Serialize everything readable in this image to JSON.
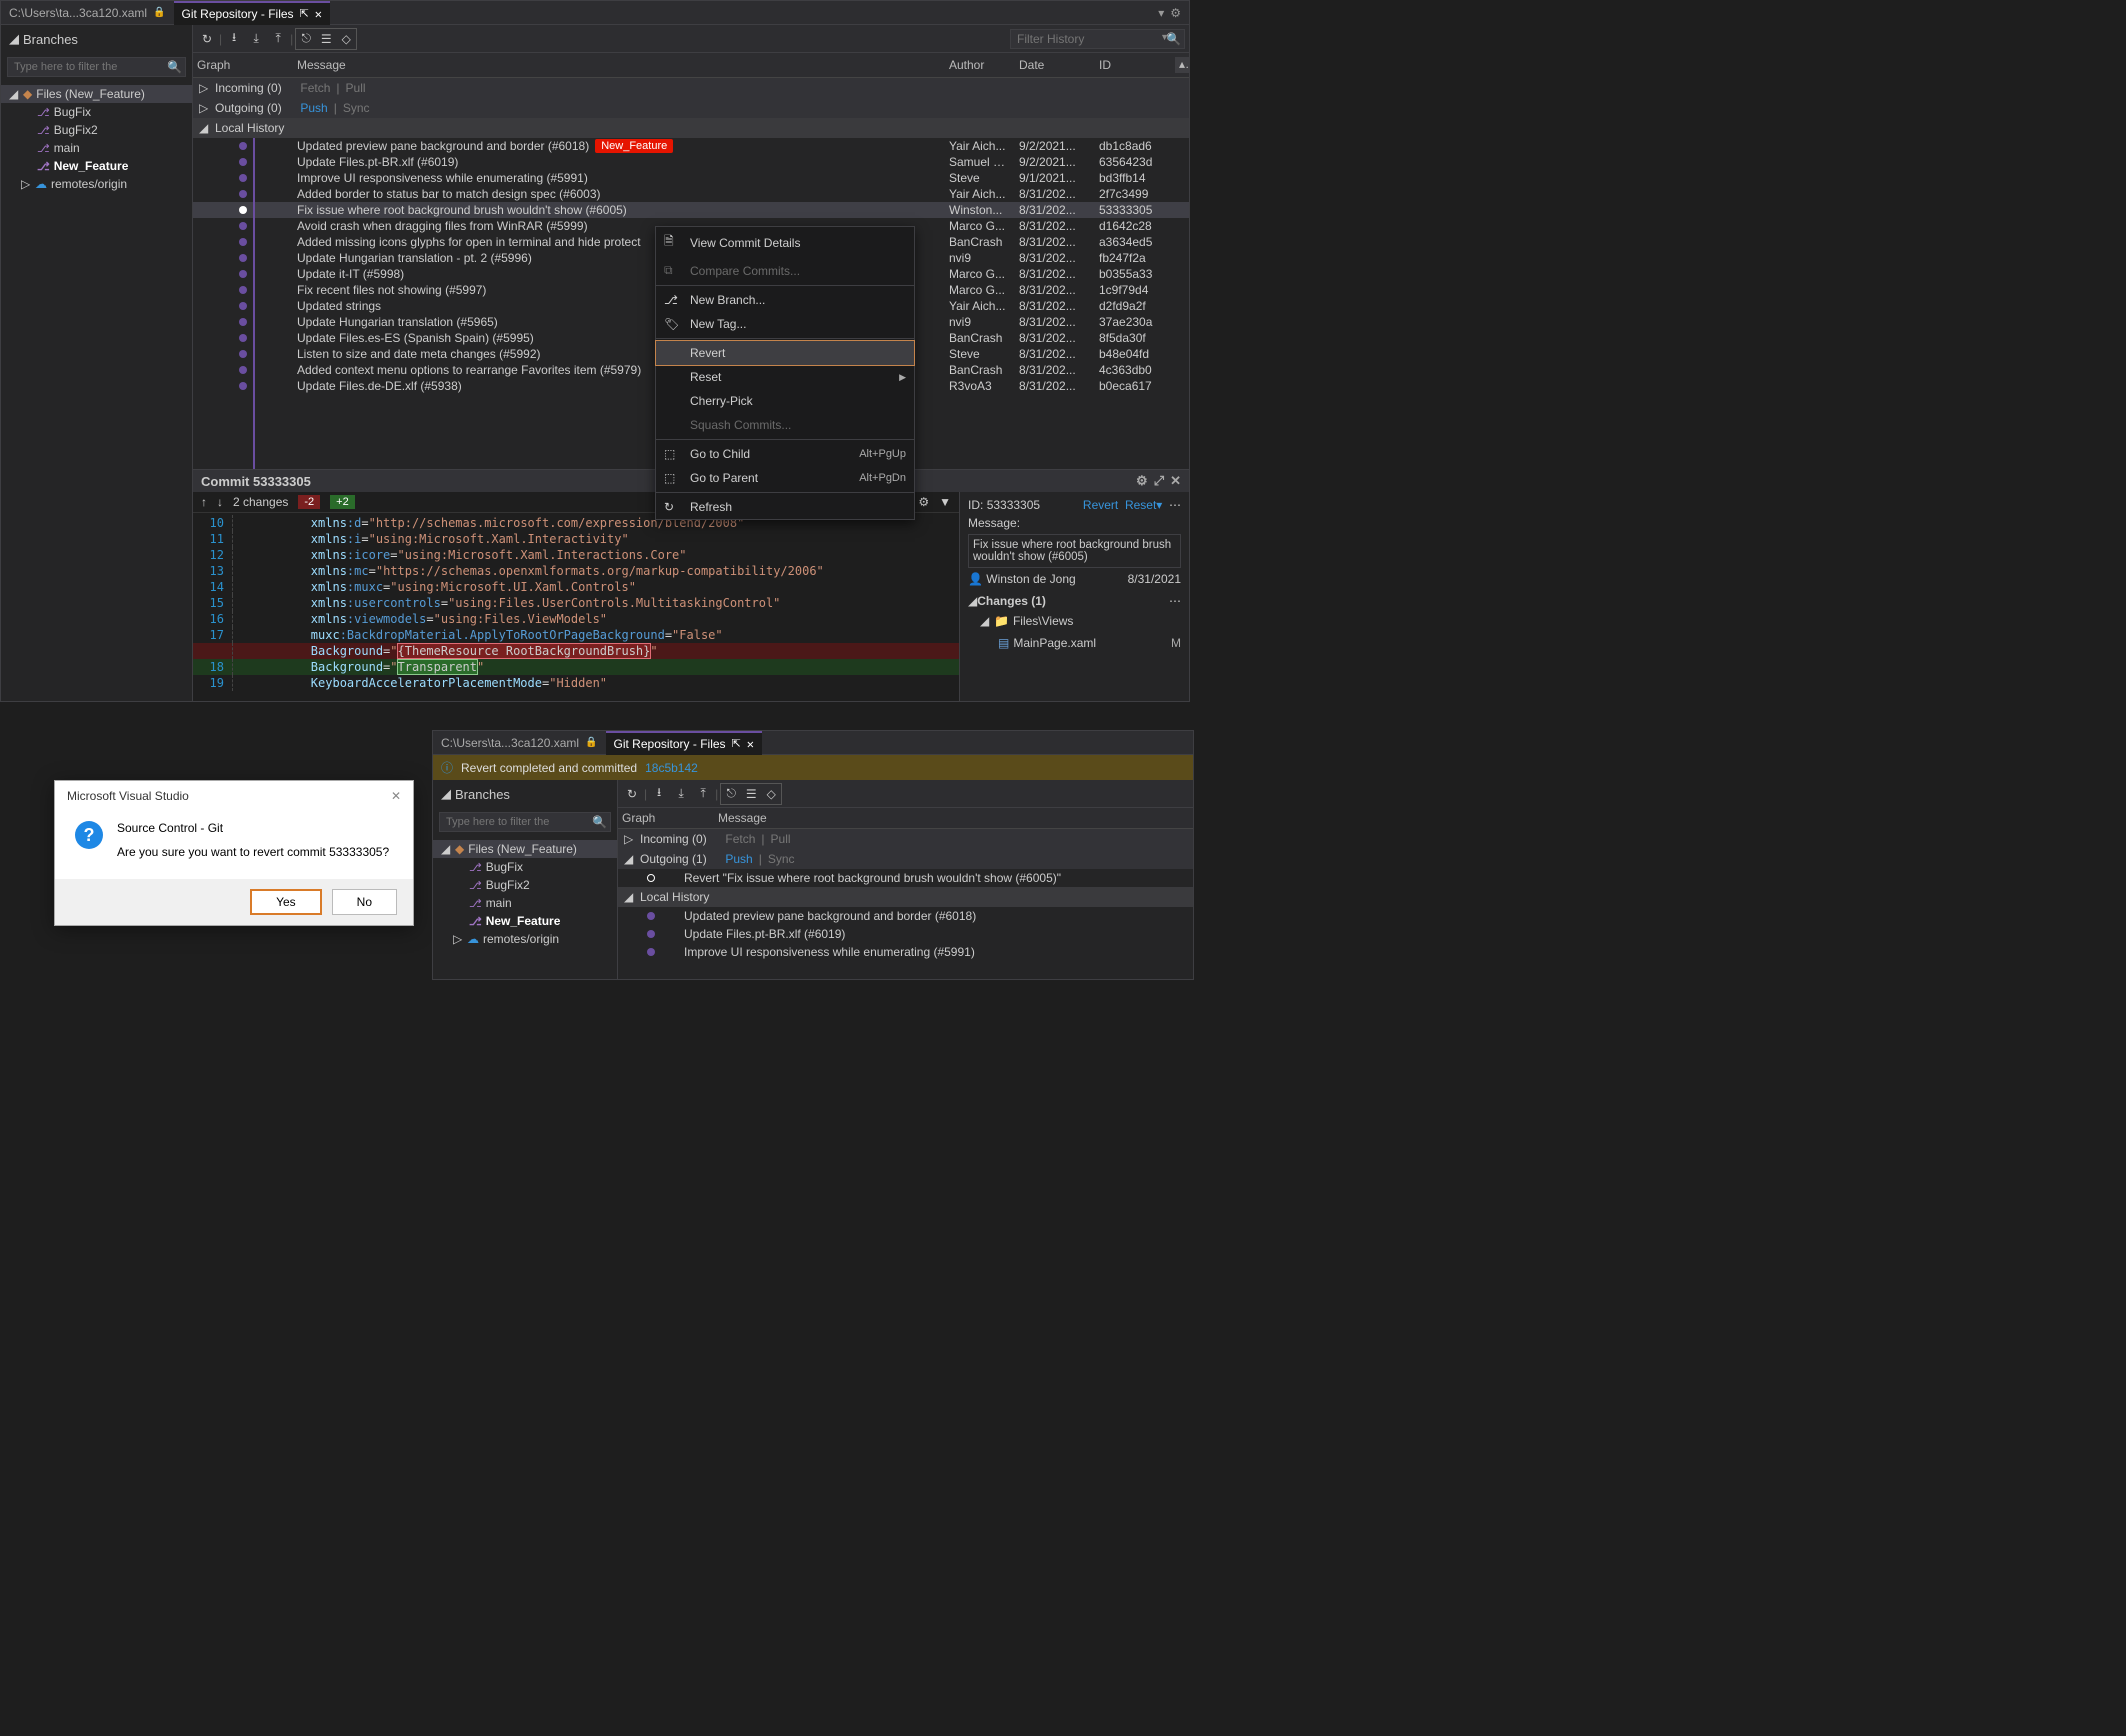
{
  "tabs": {
    "file_tab": "C:\\Users\\ta...3ca120.xaml",
    "repo_tab": "Git Repository - Files"
  },
  "branches_panel": {
    "title": "Branches",
    "search_placeholder": "Type here to filter the",
    "root": "Files (New_Feature)",
    "branches": [
      "BugFix",
      "BugFix2",
      "main",
      "New_Feature"
    ],
    "remotes": "remotes/origin"
  },
  "history": {
    "filter_placeholder": "Filter History",
    "cols": {
      "graph": "Graph",
      "message": "Message",
      "author": "Author",
      "date": "Date",
      "id": "ID"
    },
    "incoming": {
      "label": "Incoming (0)",
      "fetch": "Fetch",
      "pull": "Pull"
    },
    "outgoing": {
      "label": "Outgoing (0)",
      "push": "Push",
      "sync": "Sync"
    },
    "local_header": "Local History",
    "selected_badge": "New_Feature",
    "commits": [
      {
        "msg": "Updated preview pane background and border (#6018)",
        "author": "Yair Aich...",
        "date": "9/2/2021...",
        "id": "db1c8ad6",
        "badge": true
      },
      {
        "msg": "Update Files.pt-BR.xlf (#6019)",
        "author": "Samuel R...",
        "date": "9/2/2021...",
        "id": "6356423d"
      },
      {
        "msg": "Improve UI responsiveness while enumerating (#5991)",
        "author": "Steve",
        "date": "9/1/2021...",
        "id": "bd3ffb14"
      },
      {
        "msg": "Added border to status bar to match design spec (#6003)",
        "author": "Yair Aich...",
        "date": "8/31/202...",
        "id": "2f7c3499"
      },
      {
        "msg": "Fix issue where root background brush wouldn't show (#6005)",
        "author": "Winston...",
        "date": "8/31/202...",
        "id": "53333305",
        "selected": true
      },
      {
        "msg": " Avoid crash when dragging files from WinRAR (#5999)",
        "author": "Marco G...",
        "date": "8/31/202...",
        "id": "d1642c28"
      },
      {
        "msg": "Added missing icons glyphs for open in terminal and hide protect",
        "author": "BanCrash",
        "date": "8/31/202...",
        "id": "a3634ed5"
      },
      {
        "msg": "Update Hungarian translation - pt. 2 (#5996)",
        "author": "nvi9",
        "date": "8/31/202...",
        "id": "fb247f2a"
      },
      {
        "msg": "Update it-IT (#5998)",
        "author": "Marco G...",
        "date": "8/31/202...",
        "id": "b0355a33"
      },
      {
        "msg": "Fix recent files not showing (#5997)",
        "author": "Marco G...",
        "date": "8/31/202...",
        "id": "1c9f79d4"
      },
      {
        "msg": "Updated strings",
        "author": "Yair Aich...",
        "date": "8/31/202...",
        "id": "d2fd9a2f"
      },
      {
        "msg": "Update Hungarian translation (#5965)",
        "author": "nvi9",
        "date": "8/31/202...",
        "id": "37ae230a"
      },
      {
        "msg": "Update Files.es-ES (Spanish Spain) (#5995)",
        "author": "BanCrash",
        "date": "8/31/202...",
        "id": "8f5da30f"
      },
      {
        "msg": "Listen to size and date meta changes (#5992)",
        "author": "Steve",
        "date": "8/31/202...",
        "id": "b48e04fd"
      },
      {
        "msg": "Added context menu options to rearrange Favorites item (#5979)",
        "author": "BanCrash",
        "date": "8/31/202...",
        "id": "4c363db0"
      },
      {
        "msg": "Update Files.de-DE.xlf (#5938)",
        "author": "R3voA3",
        "date": "8/31/202...",
        "id": "b0eca617"
      }
    ]
  },
  "context_menu": {
    "view_details": "View Commit Details",
    "compare": "Compare Commits...",
    "new_branch": "New Branch...",
    "new_tag": "New Tag...",
    "revert": "Revert",
    "reset": "Reset",
    "cherry": "Cherry-Pick",
    "squash": "Squash Commits...",
    "go_child": "Go to Child",
    "go_child_sc": "Alt+PgUp",
    "go_parent": "Go to Parent",
    "go_parent_sc": "Alt+PgDn",
    "refresh": "Refresh"
  },
  "diff": {
    "title": "Commit 53333305",
    "changes_label": "2 changes",
    "neg": "-2",
    "pos": "+2",
    "lines": [
      {
        "n": "10",
        "pre": "        ",
        "k": "xmlns",
        "a": ":d",
        "v": "\"http://schemas.microsoft.com/expression/blend/2008\""
      },
      {
        "n": "11",
        "pre": "        ",
        "k": "xmlns",
        "a": ":i",
        "v": "\"using:Microsoft.Xaml.Interactivity\""
      },
      {
        "n": "12",
        "pre": "        ",
        "k": "xmlns",
        "a": ":icore",
        "v": "\"using:Microsoft.Xaml.Interactions.Core\""
      },
      {
        "n": "13",
        "pre": "        ",
        "k": "xmlns",
        "a": ":mc",
        "v": "\"https://schemas.openxmlformats.org/markup-compatibility/2006\""
      },
      {
        "n": "14",
        "pre": "        ",
        "k": "xmlns",
        "a": ":muxc",
        "v": "\"using:Microsoft.UI.Xaml.Controls\""
      },
      {
        "n": "15",
        "pre": "        ",
        "k": "xmlns",
        "a": ":usercontrols",
        "v": "\"using:Files.UserControls.MultitaskingControl\""
      },
      {
        "n": "16",
        "pre": "        ",
        "k": "xmlns",
        "a": ":viewmodels",
        "v": "\"using:Files.ViewModels\""
      },
      {
        "n": "17",
        "pre": "        ",
        "k": "muxc",
        "a": ":BackdropMaterial.ApplyToRootOrPageBackground",
        "v": "\"False\""
      },
      {
        "n": "",
        "pre": "        ",
        "k": "Background",
        "a": "",
        "v": "\"",
        "frag": "{ThemeResource RootBackgroundBrush}",
        "post": "\"",
        "del": true
      },
      {
        "n": "18",
        "pre": "        ",
        "k": "Background",
        "a": "",
        "v": "\"",
        "frag": "Transparent",
        "post": "\"",
        "add": true
      },
      {
        "n": "19",
        "pre": "        ",
        "k": "KeyboardAcceleratorPlacementMode",
        "a": "",
        "v": "\"Hidden\""
      }
    ]
  },
  "detail": {
    "id_label": "ID:",
    "id_val": "53333305",
    "revert": "Revert",
    "reset": "Reset",
    "msg_label": "Message:",
    "msg": "Fix issue where root background brush wouldn't show (#6005)",
    "author": "Winston de Jong",
    "date": "8/31/2021",
    "changes_header": "Changes (1)",
    "folder": "Files\\Views",
    "file": "MainPage.xaml",
    "file_mark": "M"
  },
  "dialog": {
    "title": "Microsoft Visual Studio",
    "heading": "Source Control - Git",
    "body": "Are you sure you want to revert commit 53333305?",
    "yes": "Yes",
    "no": "No"
  },
  "second": {
    "banner_text": "Revert completed and committed",
    "banner_link": "18c5b142",
    "outgoing": {
      "label": "Outgoing (1)",
      "push": "Push",
      "sync": "Sync"
    },
    "incoming": {
      "label": "Incoming (0)",
      "fetch": "Fetch",
      "pull": "Pull"
    },
    "local": "Local History",
    "revert_msg": "Revert \"Fix issue where root background brush wouldn't show (#6005)\"",
    "commits": [
      "Updated preview pane background and border (#6018)",
      "Update Files.pt-BR.xlf (#6019)",
      "Improve UI responsiveness while enumerating (#5991)"
    ]
  }
}
